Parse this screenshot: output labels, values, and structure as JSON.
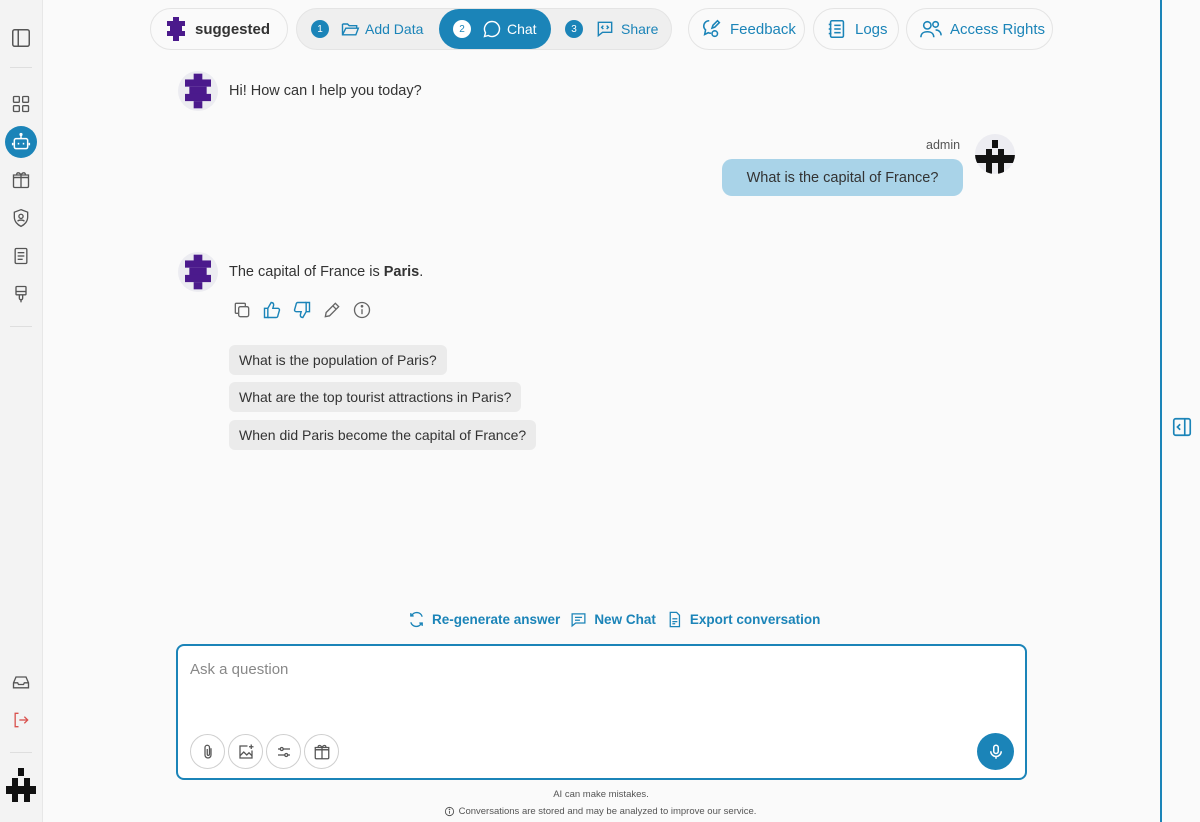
{
  "colors": {
    "accent": "#1b84b8",
    "user_bubble": "#a9d3e8",
    "brand_purple": "#4b1a8c",
    "logout": "#d9534f"
  },
  "sidebar": {
    "items": [
      {
        "icon": "sidebar-toggle-icon"
      },
      {
        "icon": "grid-icon"
      },
      {
        "icon": "robot-icon",
        "active": true
      },
      {
        "icon": "gift-box-icon"
      },
      {
        "icon": "shield-user-icon"
      },
      {
        "icon": "document-icon"
      },
      {
        "icon": "brush-icon"
      },
      {
        "icon": "inbox-icon"
      },
      {
        "icon": "logout-icon"
      }
    ]
  },
  "header": {
    "assistant_name": "suggested",
    "steps": [
      {
        "num": "1",
        "label": "Add Data",
        "icon": "folder-open-icon"
      },
      {
        "num": "2",
        "label": "Chat",
        "icon": "chat-bubble-icon",
        "active": true
      },
      {
        "num": "3",
        "label": "Share",
        "icon": "code-share-icon"
      }
    ],
    "feedback_label": "Feedback",
    "logs_label": "Logs",
    "access_label": "Access Rights"
  },
  "messages": {
    "greeting": "Hi! How can I help you today?",
    "user_name": "admin",
    "user_question": "What is the capital of France?",
    "answer_prefix": "The capital of France is ",
    "answer_bold": "Paris",
    "answer_suffix": "."
  },
  "suggestions": [
    "What is the population of Paris?",
    "What are the top tourist attractions in Paris?",
    "When did Paris become the capital of France?"
  ],
  "footer_links": {
    "regenerate": "Re-generate answer",
    "new_chat": "New Chat",
    "export": "Export conversation"
  },
  "composer": {
    "placeholder": "Ask a question"
  },
  "disclaimer": {
    "line1": "AI can make mistakes.",
    "line2": "Conversations are stored and may be analyzed to improve our service."
  }
}
